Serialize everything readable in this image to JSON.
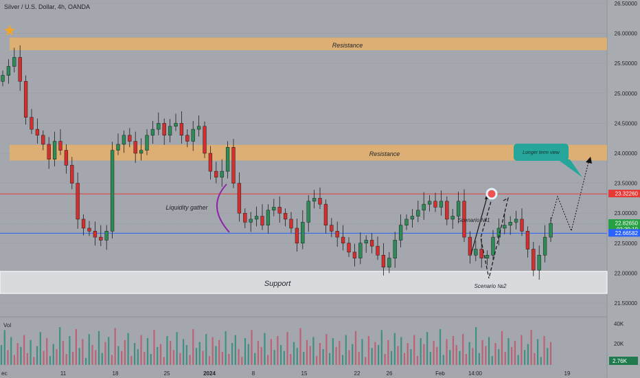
{
  "symbol_title": "Silver / U.S. Dollar, 4h, OANDA",
  "volume_label": "Vol",
  "colors": {
    "background": "#a3a6ab",
    "bull": "#2e8b57",
    "bear": "#d32f2f",
    "zone_resistance": "#e8b06a",
    "zone_support": "#e6e7ea",
    "resistance_line": "#e53935",
    "price_line": "#2962ff",
    "teal_callout": "#26a69a"
  },
  "chart_data": {
    "type": "candlestick",
    "ylim": [
      21.5,
      26.5
    ],
    "price_ticks": [
      "26.50000",
      "26.00000",
      "25.50000",
      "25.00000",
      "24.50000",
      "24.00000",
      "23.50000",
      "23.00000",
      "22.50000",
      "22.00000",
      "21.50000"
    ],
    "x_ticks": [
      "ec",
      "11",
      "18",
      "25",
      "2024",
      "8",
      "15",
      "22",
      "26",
      "Feb",
      "14:00",
      "19"
    ],
    "zones": [
      {
        "label": "Resistance",
        "low": 25.72,
        "high": 25.93
      },
      {
        "label": "Resistance",
        "low": 23.88,
        "high": 24.14
      },
      {
        "label": "Support",
        "low": 21.66,
        "high": 22.03
      }
    ],
    "lines": [
      {
        "name": "resistance-line",
        "value": 23.3226
      },
      {
        "name": "current-price-line",
        "value": 22.6658
      }
    ],
    "price_labels": [
      {
        "text": "23.32260",
        "value": 23.3226,
        "color": "#e53935"
      },
      {
        "text": "22.82650",
        "value": 22.8265,
        "color": "#26a042"
      },
      {
        "text": "03:39:19",
        "value": 22.7315,
        "color": "#26a042"
      },
      {
        "text": "22.66582",
        "value": 22.6658,
        "color": "#2962ff"
      }
    ],
    "annotations": [
      {
        "text": "Liquidity gather"
      },
      {
        "text": "Scenario №1"
      },
      {
        "text": "Scenario №2"
      },
      {
        "text": "Longer term view"
      }
    ],
    "closes": [
      25.3,
      25.45,
      25.6,
      25.2,
      24.6,
      24.4,
      24.3,
      24.15,
      23.9,
      24.2,
      24.05,
      23.8,
      23.5,
      22.9,
      22.75,
      22.7,
      22.6,
      22.55,
      22.7,
      24.05,
      24.15,
      24.3,
      24.2,
      24.0,
      24.05,
      24.3,
      24.4,
      24.5,
      24.3,
      24.45,
      24.5,
      24.3,
      24.2,
      24.4,
      24.45,
      24.0,
      23.7,
      23.6,
      23.7,
      24.1,
      23.5,
      23.0,
      22.85,
      22.9,
      22.95,
      22.8,
      23.05,
      23.1,
      23.0,
      22.9,
      22.75,
      22.5,
      22.85,
      23.2,
      23.25,
      23.15,
      22.8,
      22.7,
      22.6,
      22.5,
      22.35,
      22.25,
      22.5,
      22.55,
      22.45,
      22.3,
      22.1,
      22.25,
      22.55,
      22.8,
      22.9,
      22.95,
      23.05,
      23.15,
      23.2,
      23.1,
      23.2,
      22.9,
      22.95,
      23.2,
      22.6,
      22.3,
      22.4,
      22.25,
      22.3,
      22.6,
      22.75,
      22.8,
      22.85,
      22.9,
      22.7,
      22.4,
      22.05,
      22.3,
      22.6,
      22.83
    ],
    "volumes": [
      20,
      35,
      15,
      28,
      10,
      22,
      18,
      30,
      12,
      25,
      8,
      19,
      33,
      14,
      27,
      9,
      21,
      16,
      38,
      24,
      11,
      29,
      13,
      36,
      17,
      26,
      7,
      31,
      20,
      15,
      34,
      12,
      23,
      28,
      10,
      37,
      19,
      14,
      25,
      32,
      9,
      22,
      16,
      30,
      13,
      27,
      11,
      35,
      18,
      21,
      8,
      29,
      24,
      15,
      33,
      12,
      26,
      20,
      10,
      36,
      17,
      23,
      14,
      31,
      9,
      28,
      19,
      25,
      13,
      34,
      11,
      22,
      30,
      16,
      8,
      27,
      21,
      35,
      12,
      24,
      18,
      32,
      10,
      26,
      15,
      29,
      20,
      14,
      33,
      11,
      23,
      17,
      37,
      13,
      25,
      19,
      28,
      9,
      22,
      16,
      31,
      12,
      27,
      18,
      24,
      10,
      30,
      15,
      21,
      34,
      13,
      26,
      8,
      29,
      17,
      23,
      20,
      35,
      11,
      25,
      14,
      32,
      19,
      28,
      12,
      22,
      16,
      30,
      9,
      27,
      21,
      33,
      13,
      24,
      18,
      36,
      10,
      26,
      15,
      29,
      20,
      14,
      31,
      11,
      23,
      17,
      38,
      12,
      25,
      19,
      28,
      9,
      22,
      16,
      34,
      13,
      27,
      18,
      24,
      10,
      30,
      15,
      21,
      35,
      12,
      26,
      8,
      29,
      17,
      23
    ],
    "vol_ticks": [
      "40K",
      "20K"
    ],
    "vol_current": "2.76K"
  }
}
